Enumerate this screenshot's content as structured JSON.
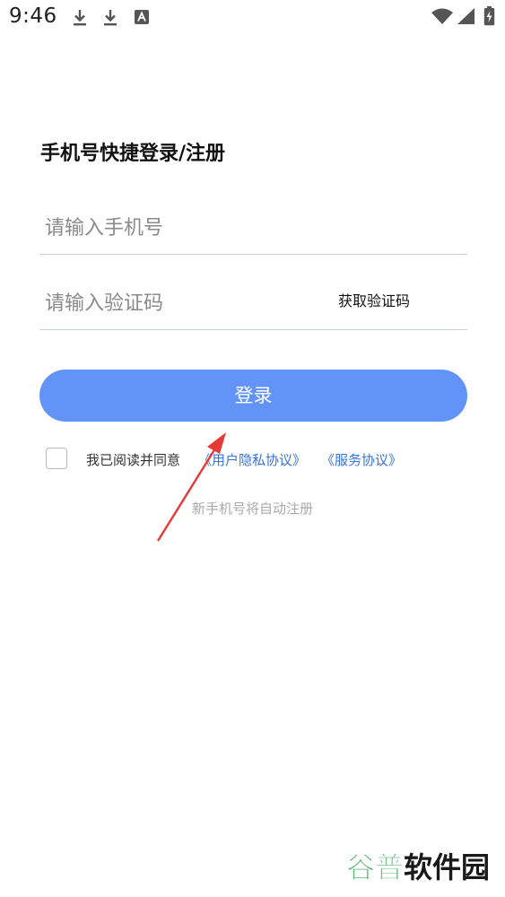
{
  "status_bar": {
    "time": "9:46",
    "icons": [
      "download-icon",
      "download-icon",
      "font-app-icon",
      "wifi-icon",
      "cell-signal-icon",
      "battery-charging-icon"
    ]
  },
  "page": {
    "title": "手机号快捷登录/注册"
  },
  "form": {
    "phone_placeholder": "请输入手机号",
    "code_placeholder": "请输入验证码",
    "get_code_label": "获取验证码",
    "login_label": "登录"
  },
  "agreement": {
    "prefix": "我已阅读并同意",
    "privacy_link": "《用户隐私协议》",
    "service_link": "《服务协议》",
    "checked": false
  },
  "hint": "新手机号将自动注册",
  "watermark": {
    "text": "谷普软件园"
  },
  "colors": {
    "accent": "#6294f8",
    "link": "#3874d8",
    "annotation": "#e53935"
  }
}
